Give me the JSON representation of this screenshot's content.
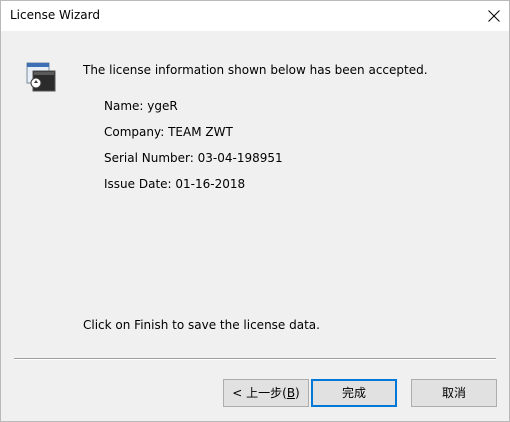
{
  "window": {
    "title": "License Wizard"
  },
  "icons": {
    "close": "close-icon",
    "app": "license-wizard-icon"
  },
  "content": {
    "heading": "The license information shown below has been accepted.",
    "fields": [
      {
        "label": "Name:",
        "value": "ygeR"
      },
      {
        "label": "Company:",
        "value": "TEAM ZWT"
      },
      {
        "label": "Serial Number:",
        "value": "03-04-198951"
      },
      {
        "label": "Issue Date:",
        "value": "01-16-2018"
      }
    ],
    "footer": "Click on Finish to save the license data."
  },
  "buttons": {
    "back_prefix": "< 上一步(",
    "back_key": "B",
    "back_suffix": ")",
    "finish": "完成",
    "cancel": "取消"
  },
  "colors": {
    "default_button_border": "#0078d7",
    "dialog_background": "#f0f0f0",
    "titlebar_background": "#ffffff"
  }
}
